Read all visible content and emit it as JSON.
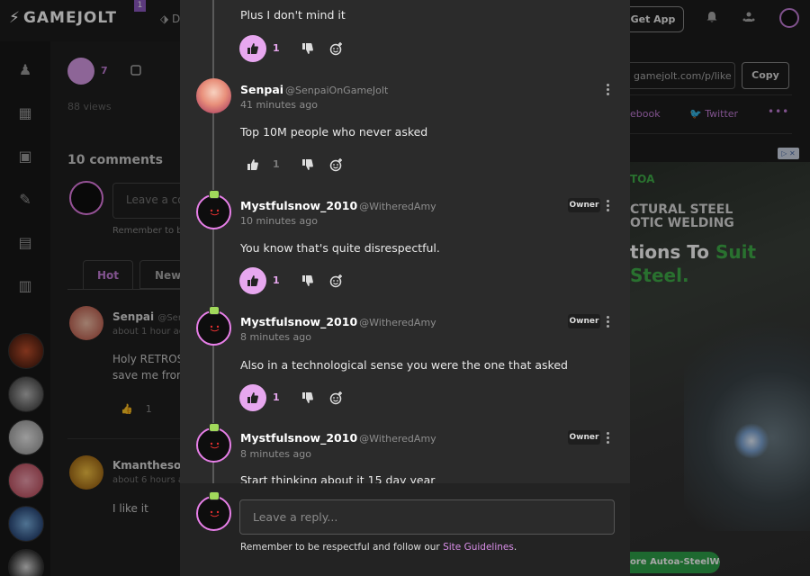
{
  "topbar": {
    "logo_text": "GAMEJOLT",
    "notification_count": "1",
    "partial_nav": "D",
    "get_app_label": "Get App"
  },
  "background_post": {
    "like_count": "7",
    "views": "88 views",
    "comments_heading": "10 comments",
    "comment_placeholder": "Leave a co",
    "remember_text": "Remember to b",
    "tabs": [
      "Hot",
      "New"
    ],
    "comments": [
      {
        "name": "Senpai",
        "handle": "@Senp",
        "time": "about 1 hour ag",
        "text_line1": "Holy RETROS",
        "text_line2": "save me from",
        "likes": "1"
      },
      {
        "name": "Kmanthesoni",
        "handle": "",
        "time": "about 6 hours a",
        "text_line1": "I like it",
        "text_line2": ""
      }
    ]
  },
  "share_panel": {
    "url_text": "gamejolt.com/p/like",
    "copy_label": "Copy",
    "facebook_label": "ebook",
    "twitter_label": "Twitter",
    "more_label": "•••"
  },
  "ad": {
    "flag": "▷ ✕",
    "logo": "TOA",
    "line1": "CTURAL STEEL",
    "line2": "OTIC WELDING",
    "line3_a": "tions To ",
    "line3_b": "Suit",
    "line4": "Steel.",
    "cta": "ore Autoa-SteelWeld"
  },
  "thread": {
    "top_text": "Plus I don't mind it",
    "top_likes": "1",
    "comments": [
      {
        "name": "Senpai",
        "handle": "@SenpaiOnGameJolt",
        "time": "41 minutes ago",
        "text": "Top 10M people who never asked",
        "likes": "1",
        "liked": false,
        "owner": false
      },
      {
        "name": "Mystfulsnow_2010",
        "handle": "@WitheredAmy",
        "time": "10 minutes ago",
        "text": "You know that's quite disrespectful.",
        "likes": "1",
        "liked": true,
        "owner": true
      },
      {
        "name": "Mystfulsnow_2010",
        "handle": "@WitheredAmy",
        "time": "8 minutes ago",
        "text": "Also in a technological sense you were the one that asked",
        "likes": "1",
        "liked": true,
        "owner": true
      },
      {
        "name": "Mystfulsnow_2010",
        "handle": "@WitheredAmy",
        "time": "8 minutes ago",
        "text": "Start thinking about it 15 day year",
        "owner": true
      }
    ],
    "owner_tag": "Owner"
  },
  "reply": {
    "placeholder": "Leave a reply...",
    "note_prefix": "Remember to be respectful and follow our ",
    "note_link": "Site Guidelines",
    "note_suffix": "."
  },
  "colors": {
    "accent": "#e7a7ef",
    "modal_bg": "#2b2b2b",
    "owner_dot": "#a1d95b"
  }
}
